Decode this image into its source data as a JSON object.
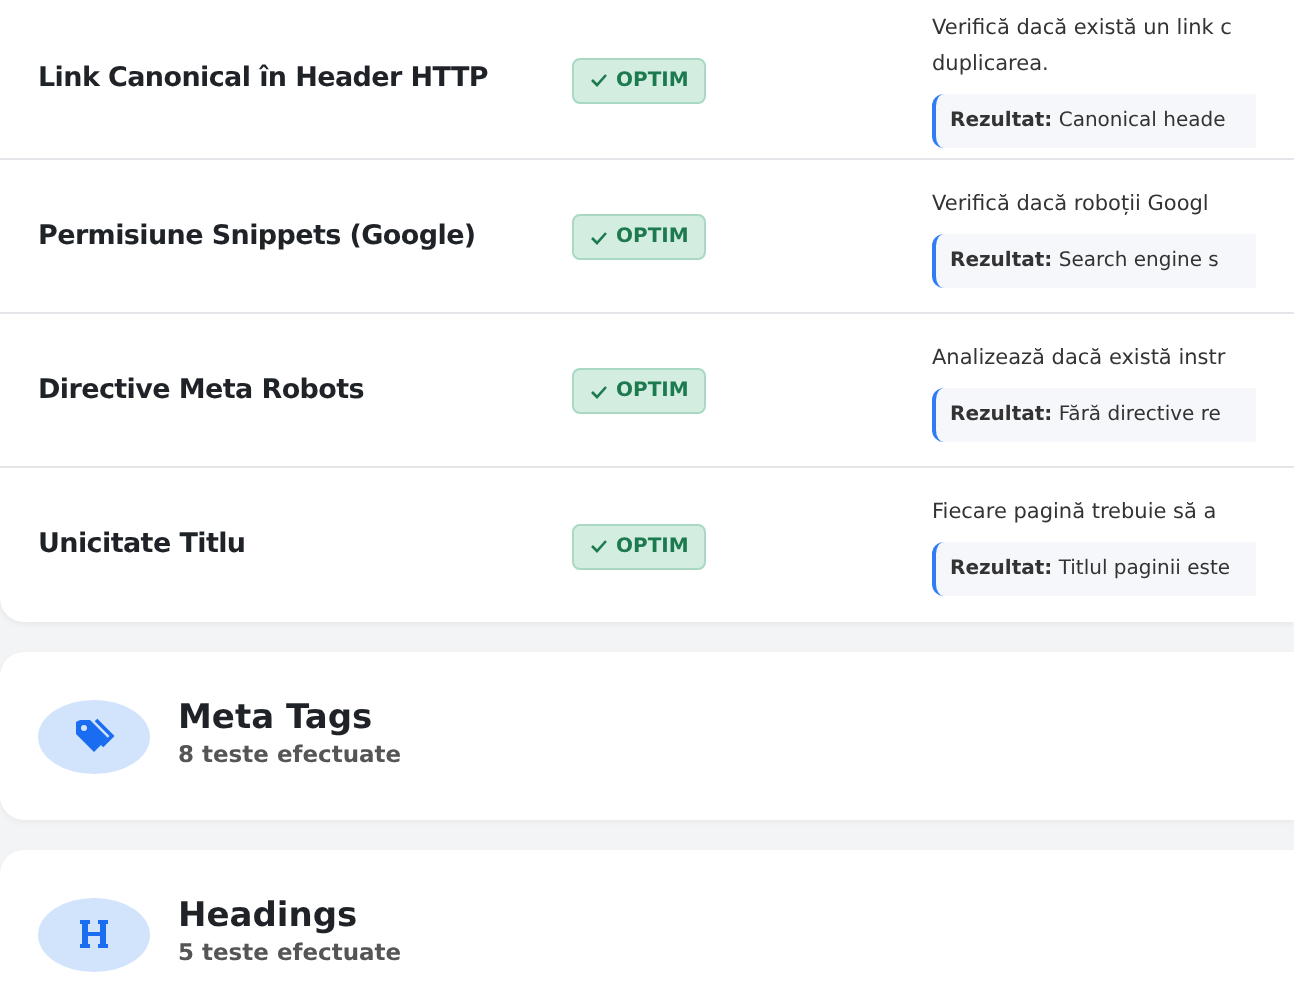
{
  "checks": [
    {
      "name": "Link Canonical în Header HTTP",
      "status": "OPTIM",
      "description_lines": [
        "Verifică dacă există un link c",
        "duplicarea."
      ],
      "result_label": "Rezultat:",
      "result": "Canonical heade"
    },
    {
      "name": "Permisiune Snippets (Google)",
      "status": "OPTIM",
      "description_lines": [
        "Verifică dacă roboții Googl"
      ],
      "result_label": "Rezultat:",
      "result": "Search engine s"
    },
    {
      "name": "Directive Meta Robots",
      "status": "OPTIM",
      "description_lines": [
        "Analizează dacă există instr"
      ],
      "result_label": "Rezultat:",
      "result": "Fără directive re"
    },
    {
      "name": "Unicitate Titlu",
      "status": "OPTIM",
      "description_lines": [
        "Fiecare pagină trebuie să a"
      ],
      "result_label": "Rezultat:",
      "result": "Titlul paginii este"
    }
  ],
  "sections": [
    {
      "kind": "tags",
      "title": "Meta Tags",
      "count": "8 teste efectuate"
    },
    {
      "kind": "heading",
      "title": "Headings",
      "count": "5 teste efectuate"
    }
  ]
}
